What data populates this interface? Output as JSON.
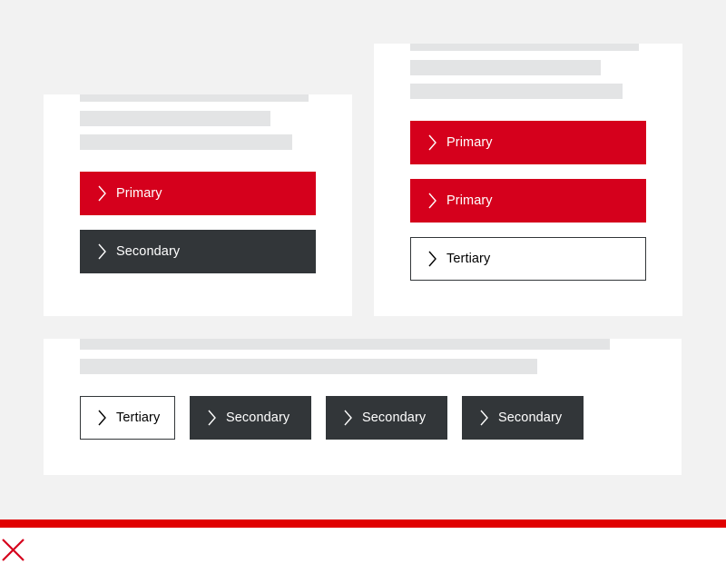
{
  "colors": {
    "page_background": "#f2f2f2",
    "card_background": "#ffffff",
    "skeleton_line": "#e3e4e5",
    "primary": "#d5001c",
    "secondary": "#323639",
    "tertiary_border": "#323639"
  },
  "card_left": {
    "buttons": [
      {
        "variant": "primary",
        "label": "Primary",
        "icon": "chevron-right-icon"
      },
      {
        "variant": "secondary",
        "label": "Secondary",
        "icon": "chevron-right-icon"
      }
    ]
  },
  "card_right": {
    "buttons": [
      {
        "variant": "primary",
        "label": "Primary",
        "icon": "chevron-right-icon"
      },
      {
        "variant": "primary",
        "label": "Primary",
        "icon": "chevron-right-icon"
      },
      {
        "variant": "tertiary",
        "label": "Tertiary",
        "icon": "chevron-right-icon"
      }
    ]
  },
  "card_bottom": {
    "buttons": [
      {
        "variant": "tertiary",
        "label": "Tertiary",
        "icon": "chevron-right-icon"
      },
      {
        "variant": "secondary",
        "label": "Secondary",
        "icon": "chevron-right-icon"
      },
      {
        "variant": "secondary",
        "label": "Secondary",
        "icon": "chevron-right-icon"
      },
      {
        "variant": "secondary",
        "label": "Secondary",
        "icon": "chevron-right-icon"
      }
    ]
  },
  "footer": {
    "bar_color": "#e00000",
    "mark_icon": "x-mark-icon",
    "mark_color": "#d5001c"
  }
}
